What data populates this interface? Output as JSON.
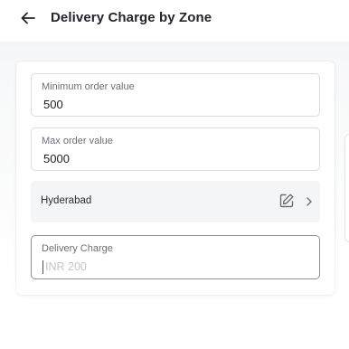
{
  "header": {
    "title": "Delivery Charge by Zone",
    "back_icon": "arrow-left-icon"
  },
  "form": {
    "min_order": {
      "label": "Minimum order value",
      "value": "500"
    },
    "max_order": {
      "label": "Max order value",
      "value": "5000"
    },
    "zone": {
      "name": "Hyderabad",
      "edit_icon": "edit-icon",
      "chevron_icon": "chevron-right-icon"
    },
    "delivery_charge": {
      "label": "Delivery Charge",
      "placeholder": "INR 200",
      "value": ""
    }
  },
  "colors": {
    "text_primary": "#1c1f22",
    "label": "#6b7075",
    "border": "#d9dcdf",
    "row_bg": "#f4f5f6",
    "placeholder": "#c2c5c9"
  }
}
